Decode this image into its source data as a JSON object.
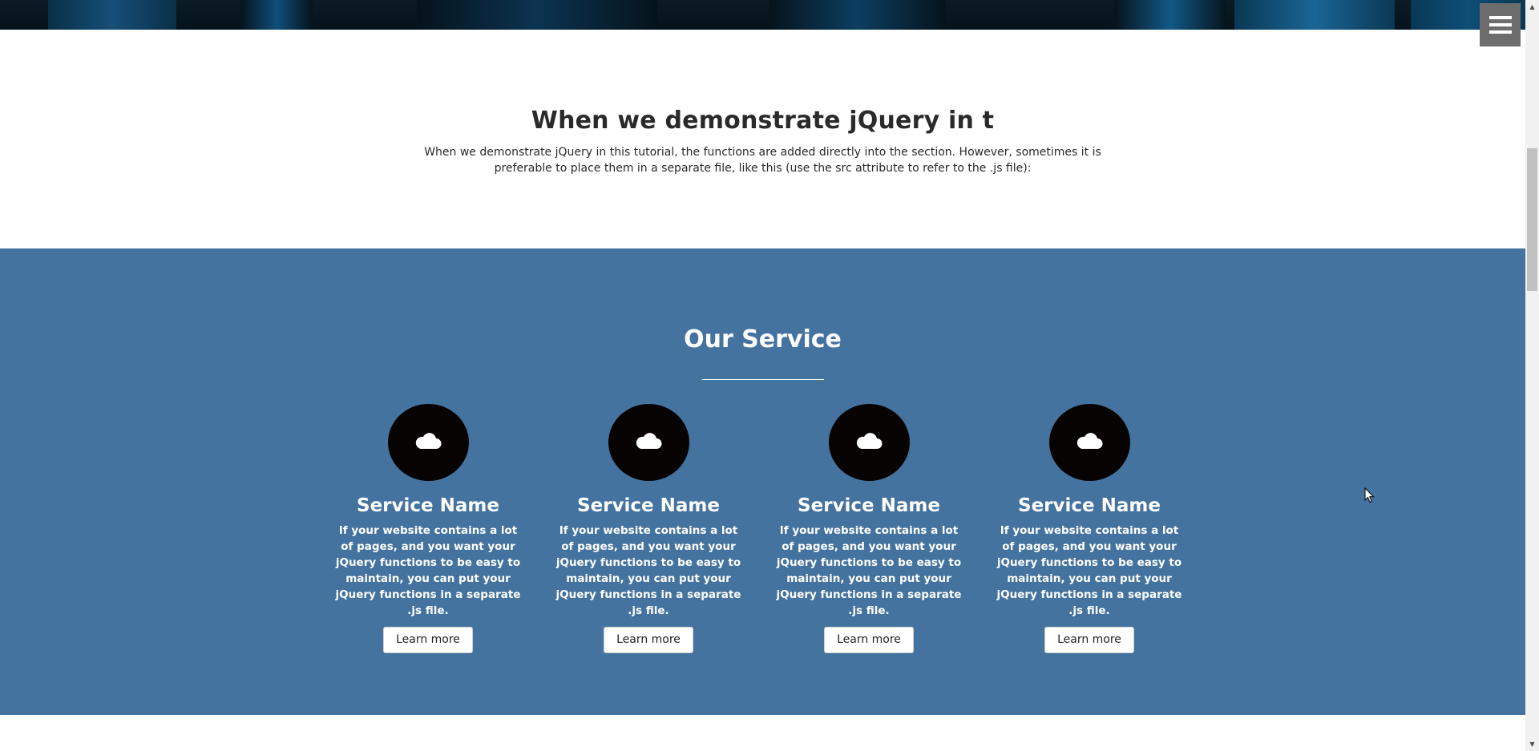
{
  "colors": {
    "service_bg": "#44739f",
    "circle_bg": "#070303",
    "menu_bg": "#6d6d6d",
    "hero_dark": "#06131c",
    "hero_blue": "#0f4f7a"
  },
  "header": {
    "menu_icon": "hamburger-icon"
  },
  "intro": {
    "title": "When we demonstrate jQuery in t",
    "text": "When we demonstrate jQuery in this tutorial, the functions are added directly into the section. However, sometimes it is preferable to place them in a separate file, like this (use the src attribute to refer to the .js file):"
  },
  "services": {
    "title": "Our Service",
    "items": [
      {
        "icon": "cloud-icon",
        "name": "Service Name",
        "description": "If your website contains a lot of pages, and you want your jQuery functions to be easy to maintain, you can put your jQuery functions in a separate .js file.",
        "button": "Learn more"
      },
      {
        "icon": "cloud-icon",
        "name": "Service Name",
        "description": "If your website contains a lot of pages, and you want your jQuery functions to be easy to maintain, you can put your jQuery functions in a separate .js file.",
        "button": "Learn more"
      },
      {
        "icon": "cloud-icon",
        "name": "Service Name",
        "description": "If your website contains a lot of pages, and you want your jQuery functions to be easy to maintain, you can put your jQuery functions in a separate .js file.",
        "button": "Learn more"
      },
      {
        "icon": "cloud-icon",
        "name": "Service Name",
        "description": "If your website contains a lot of pages, and you want your jQuery functions to be easy to maintain, you can put your jQuery functions in a separate .js file.",
        "button": "Learn more"
      }
    ]
  }
}
